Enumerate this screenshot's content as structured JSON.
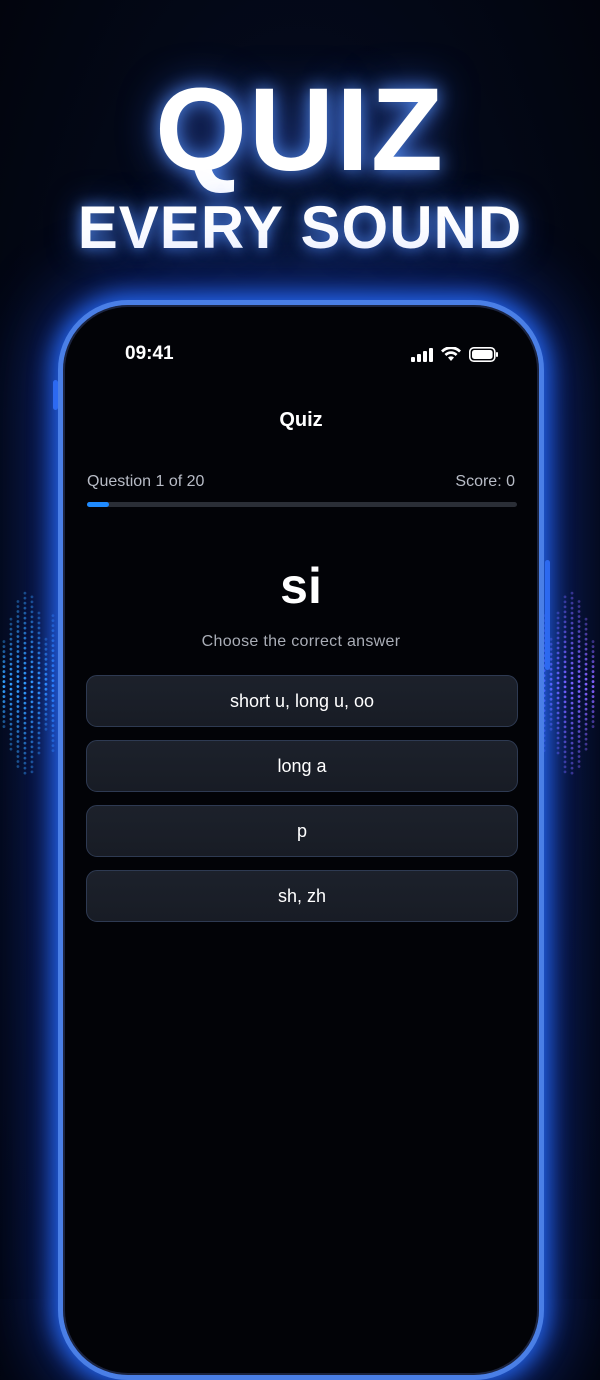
{
  "promo": {
    "headline": "QUIZ",
    "subheadline": "EVERY SOUND"
  },
  "status_bar": {
    "time": "09:41",
    "icons": [
      "signal-icon",
      "wifi-icon",
      "battery-icon"
    ]
  },
  "nav": {
    "title": "Quiz"
  },
  "progress": {
    "question_label": "Question 1 of 20",
    "score_label": "Score: 0",
    "fraction": 0.05
  },
  "question": {
    "prompt": "si",
    "instruction": "Choose the correct answer"
  },
  "options": [
    {
      "label": "short u, long u, oo"
    },
    {
      "label": "long a"
    },
    {
      "label": "p"
    },
    {
      "label": "sh, zh"
    }
  ],
  "colors": {
    "accent": "#1f8bff",
    "phone_glow": "#2d6cff",
    "wave_left": "#3fd0ff",
    "wave_right": "#b455ff"
  }
}
